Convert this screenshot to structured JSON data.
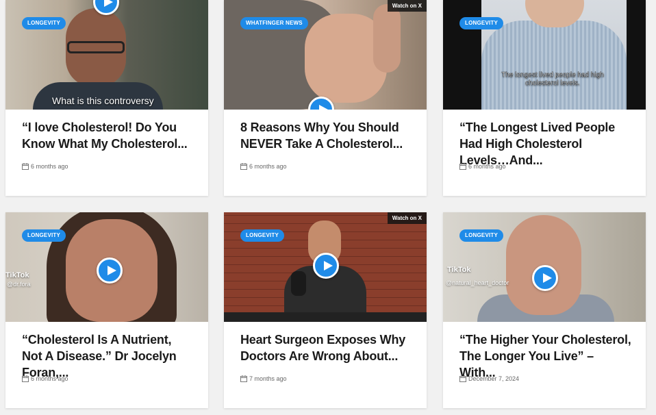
{
  "cards": [
    {
      "category": "LONGEVITY",
      "title": "“I love Cholesterol! Do You Know What My Cholesterol...",
      "date": "6 months ago",
      "caption": "What is this controversy"
    },
    {
      "category": "WHATFINGER NEWS",
      "title": "8 Reasons Why You Should NEVER Take A Cholesterol...",
      "date": "6 months ago",
      "watch_label": "Watch on X"
    },
    {
      "category": "LONGEVITY",
      "title": "“The Longest Lived People Had High Cholesterol Levels…And...",
      "date": "6 months ago",
      "caption": "The longest lived people had high cholesterol levels."
    },
    {
      "category": "LONGEVITY",
      "title": "“Cholesterol Is A Nutrient, Not A Disease.” Dr Jocelyn Foran,...",
      "date": "6 months ago",
      "tiktok": "TikTok",
      "tiktok_handle": "@dr.fora"
    },
    {
      "category": "LONGEVITY",
      "title": "Heart Surgeon Exposes Why Doctors Are Wrong About...",
      "date": "7 months ago",
      "watch_label": "Watch on X"
    },
    {
      "category": "LONGEVITY",
      "title": "“The Higher Your Cholesterol, The Longer You Live” – With...",
      "date": "December 7, 2024",
      "tiktok": "TikTok",
      "tiktok_handle": "@natural_heart_doctor"
    }
  ],
  "colors": {
    "accent": "#1f8be8",
    "card_bg": "#ffffff",
    "page_bg": "#f1f1f1"
  },
  "icons": {
    "play": "play-icon",
    "date": "calendar-icon"
  }
}
